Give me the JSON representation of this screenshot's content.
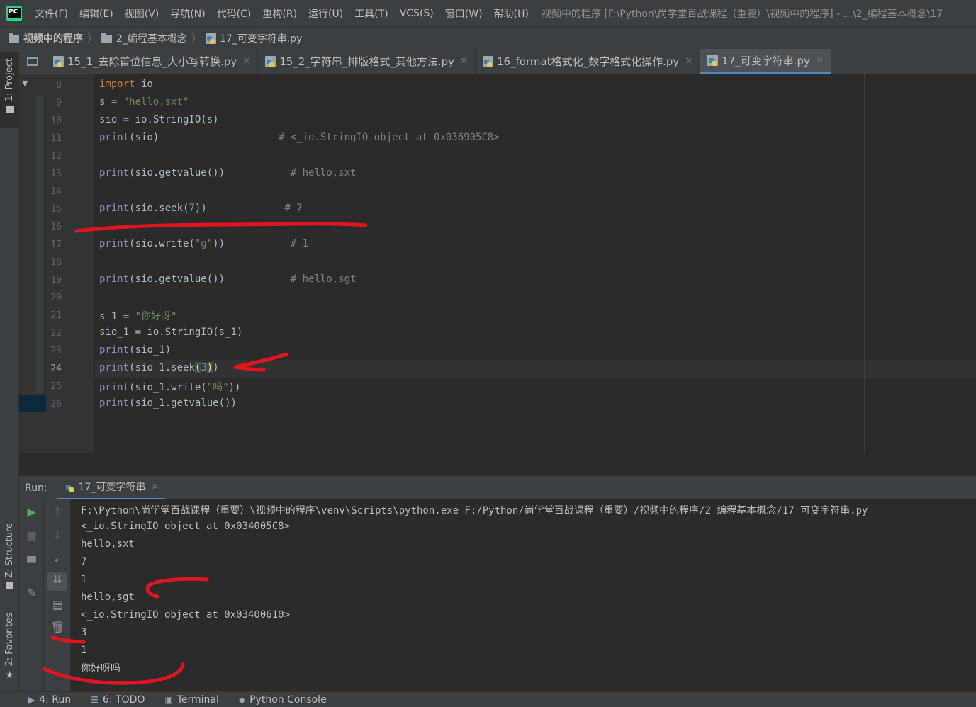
{
  "menubar": {
    "logo_text": "PC",
    "items": [
      "文件(F)",
      "编辑(E)",
      "视图(V)",
      "导航(N)",
      "代码(C)",
      "重构(R)",
      "运行(U)",
      "工具(T)",
      "VCS(S)",
      "窗口(W)",
      "帮助(H)"
    ],
    "title": "视频中的程序 [F:\\Python\\尚学堂百战课程（重要）\\视频中的程序] - ...\\2_编程基本概念\\17"
  },
  "breadcrumb": {
    "project": "视频中的程序",
    "folder": "2_编程基本概念",
    "file": "17_可变字符串.py"
  },
  "tool_windows": {
    "project": "1: Project",
    "structure": "Z: Structure",
    "favorites": "2: Favorites"
  },
  "tabs": [
    {
      "label": "15_1_去除首位信息_大小写转换.py",
      "active": false
    },
    {
      "label": "15_2_字符串_排版格式_其他方法.py",
      "active": false
    },
    {
      "label": "16_format格式化_数字格式化操作.py",
      "active": false
    },
    {
      "label": "17_可变字符串.py",
      "active": true
    }
  ],
  "editor": {
    "current_line": "24",
    "line_numbers": [
      "8",
      "9",
      "10",
      "11",
      "12",
      "13",
      "14",
      "15",
      "16",
      "17",
      "18",
      "19",
      "20",
      "21",
      "22",
      "23",
      "24",
      "25",
      "26"
    ]
  },
  "run": {
    "label": "Run:",
    "tab": "17_可变字符串",
    "output": [
      "F:\\Python\\尚学堂百战课程（重要）\\视频中的程序\\venv\\Scripts\\python.exe F:/Python/尚学堂百战课程（重要）/视频中的程序/2_编程基本概念/17_可变字符串.py",
      "<_io.StringIO object at 0x034005C8>",
      "hello,sxt",
      "7",
      "1",
      "hello,sgt",
      "<_io.StringIO object at 0x03400610>",
      "3",
      "1",
      "你好呀吗"
    ]
  },
  "statusbar": {
    "run": "4: Run",
    "todo": "6: TODO",
    "terminal": "Terminal",
    "python_console": "Python Console"
  },
  "colors": {
    "keyword": "#cc7832",
    "builtin": "#8888c6",
    "string": "#6a8759",
    "number": "#6897bb",
    "comment": "#808080",
    "annotation_ink": "#e0141e"
  }
}
